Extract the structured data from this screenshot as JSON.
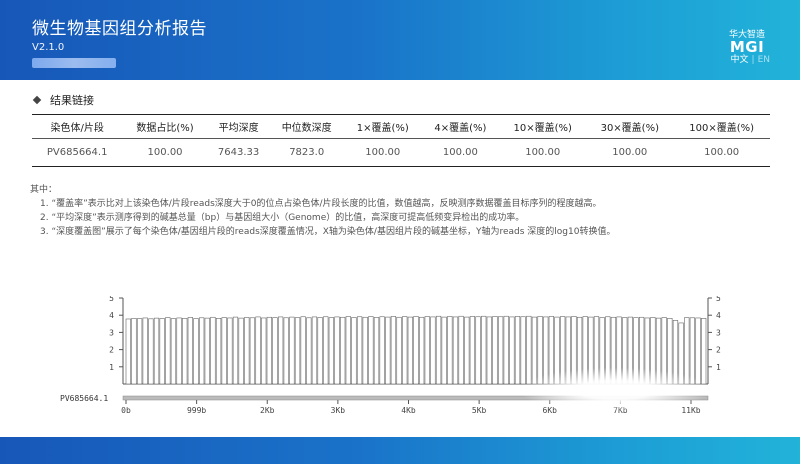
{
  "header": {
    "title": "微生物基因组分析报告",
    "version": "V2.1.0",
    "brand_cn": "华大智造",
    "brand_logo": "MGI",
    "lang_zh": "中文",
    "lang_en": "EN"
  },
  "section": {
    "title": "结果链接"
  },
  "table": {
    "headers": [
      "染色体/片段",
      "数据占比(%)",
      "平均深度",
      "中位数深度",
      "1×覆盖(%)",
      "4×覆盖(%)",
      "10×覆盖(%)",
      "30×覆盖(%)",
      "100×覆盖(%)"
    ],
    "row": [
      "PV685664.1",
      "100.00",
      "7643.33",
      "7823.0",
      "100.00",
      "100.00",
      "100.00",
      "100.00",
      "100.00"
    ]
  },
  "notes": {
    "intro": "其中：",
    "items": [
      "1. “覆盖率”表示比对上该染色体/片段reads深度大于0的位点占染色体/片段长度的比值，数值越高，反映测序数据覆盖目标序列的程度越高。",
      "2. “平均深度”表示测序得到的碱基总量（bp）与基因组大小（Genome）的比值，高深度可提高低频变异检出的成功率。",
      "3. “深度覆盖图”展示了每个染色体/基因组片段的reads深度覆盖情况，X轴为染色体/基因组片段的碱基坐标，Y轴为reads 深度的log10转换值。"
    ]
  },
  "chart_data": {
    "type": "bar",
    "label": "PV685664.1",
    "y_ticks": [
      "1",
      "2",
      "3",
      "4",
      "5"
    ],
    "ylim": [
      0,
      5
    ],
    "x_ticks": [
      "0b",
      "999b",
      "2Kb",
      "3Kb",
      "4Kb",
      "5Kb",
      "6Kb",
      "7Kb",
      "11Kb"
    ],
    "values": [
      3.78,
      3.82,
      3.8,
      3.84,
      3.79,
      3.83,
      3.81,
      3.86,
      3.8,
      3.84,
      3.82,
      3.87,
      3.81,
      3.85,
      3.83,
      3.88,
      3.82,
      3.86,
      3.84,
      3.89,
      3.83,
      3.87,
      3.85,
      3.9,
      3.84,
      3.88,
      3.86,
      3.9,
      3.85,
      3.89,
      3.86,
      3.91,
      3.85,
      3.9,
      3.87,
      3.91,
      3.86,
      3.9,
      3.88,
      3.92,
      3.87,
      3.91,
      3.88,
      3.92,
      3.87,
      3.91,
      3.89,
      3.93,
      3.88,
      3.92,
      3.89,
      3.93,
      3.88,
      3.92,
      3.9,
      3.94,
      3.89,
      3.93,
      3.9,
      3.94,
      3.89,
      3.93,
      3.91,
      3.94,
      3.9,
      3.93,
      3.91,
      3.94,
      3.9,
      3.93,
      3.91,
      3.94,
      3.89,
      3.93,
      3.9,
      3.93,
      3.89,
      3.92,
      3.9,
      3.93,
      3.88,
      3.92,
      3.89,
      3.92,
      3.87,
      3.91,
      3.88,
      3.9,
      3.86,
      3.89,
      3.86,
      3.88,
      3.84,
      3.87,
      3.83,
      3.86,
      3.82,
      3.7,
      3.55,
      3.86,
      3.85,
      3.84,
      3.82
    ]
  }
}
